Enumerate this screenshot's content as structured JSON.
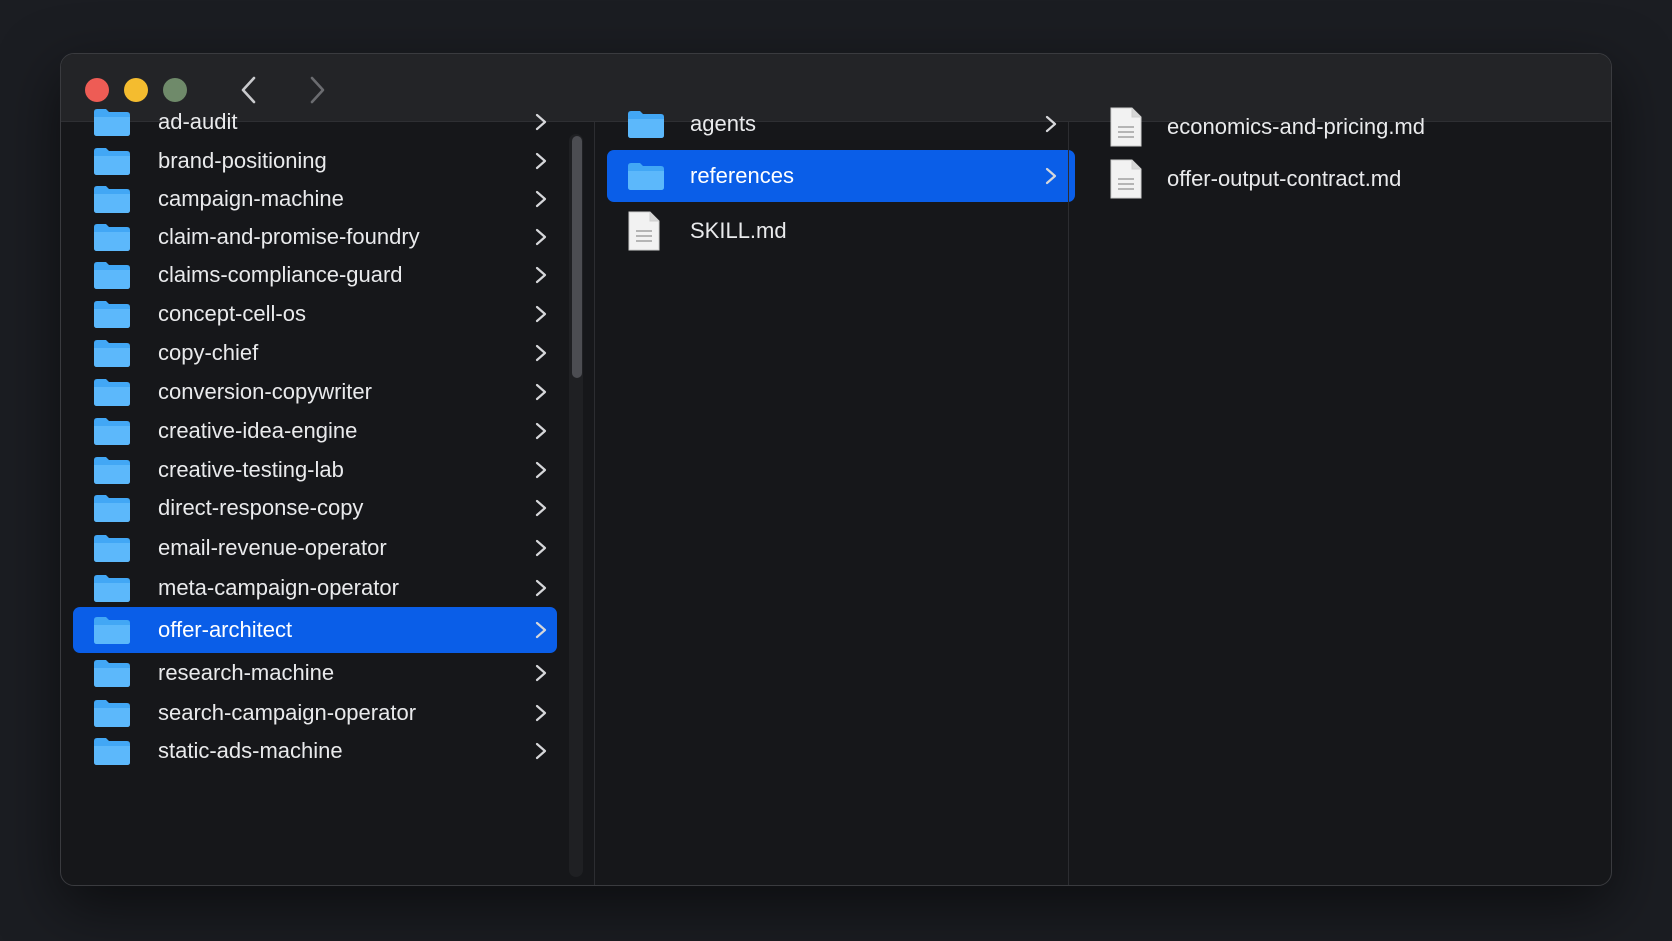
{
  "window": {
    "controls": {
      "close_color": "#ee5c55",
      "minimize_color": "#f4bc2f",
      "maximize_color": "#6f8a6a"
    }
  },
  "accent_color": "#0a5ee8",
  "folder_color": "#42a7f5",
  "columns": [
    {
      "items": [
        {
          "label": "ad-audit",
          "kind": "folder",
          "selected": false
        },
        {
          "label": "brand-positioning",
          "kind": "folder",
          "selected": false
        },
        {
          "label": "campaign-machine",
          "kind": "folder",
          "selected": false
        },
        {
          "label": "claim-and-promise-foundry",
          "kind": "folder",
          "selected": false
        },
        {
          "label": "claims-compliance-guard",
          "kind": "folder",
          "selected": false
        },
        {
          "label": "concept-cell-os",
          "kind": "folder",
          "selected": false
        },
        {
          "label": "copy-chief",
          "kind": "folder",
          "selected": false
        },
        {
          "label": "conversion-copywriter",
          "kind": "folder",
          "selected": false
        },
        {
          "label": "creative-idea-engine",
          "kind": "folder",
          "selected": false
        },
        {
          "label": "creative-testing-lab",
          "kind": "folder",
          "selected": false
        },
        {
          "label": "direct-response-copy",
          "kind": "folder",
          "selected": false
        },
        {
          "label": "email-revenue-operator",
          "kind": "folder",
          "selected": false
        },
        {
          "label": "meta-campaign-operator",
          "kind": "folder",
          "selected": false
        },
        {
          "label": "offer-architect",
          "kind": "folder",
          "selected": true
        },
        {
          "label": "research-machine",
          "kind": "folder",
          "selected": false
        },
        {
          "label": "search-campaign-operator",
          "kind": "folder",
          "selected": false
        },
        {
          "label": "static-ads-machine",
          "kind": "folder",
          "selected": false
        }
      ]
    },
    {
      "items": [
        {
          "label": "agents",
          "kind": "folder",
          "selected": false
        },
        {
          "label": "references",
          "kind": "folder",
          "selected": true
        },
        {
          "label": "SKILL.md",
          "kind": "file",
          "selected": false
        }
      ]
    },
    {
      "items": [
        {
          "label": "economics-and-pricing.md",
          "kind": "file",
          "selected": false
        },
        {
          "label": "offer-output-contract.md",
          "kind": "file",
          "selected": false
        }
      ]
    }
  ]
}
